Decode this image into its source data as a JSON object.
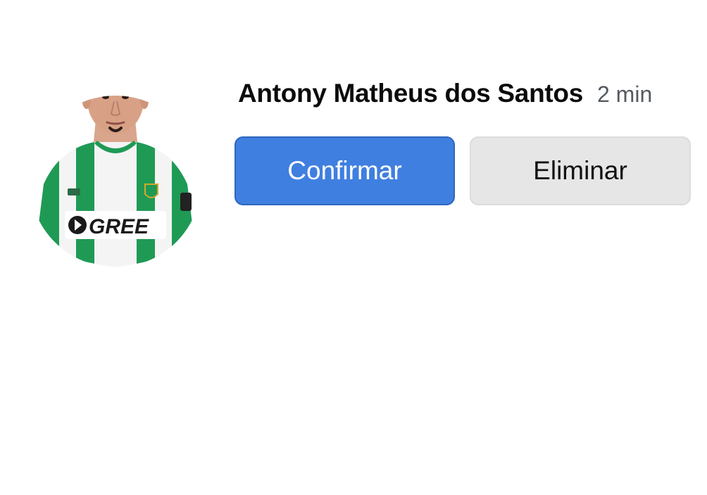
{
  "friend_request": {
    "name": "Antony Matheus dos Santos",
    "time": "2 min",
    "avatar": {
      "kit_sponsor": "GREE",
      "kit_colors": {
        "green": "#1f9a55",
        "white": "#f5f5f5"
      }
    },
    "confirm_label": "Confirmar",
    "delete_label": "Eliminar"
  },
  "colors": {
    "confirm_button": "#3f7fe0",
    "delete_button": "#e6e6e6",
    "name_text": "#0b0b0b",
    "time_text": "#555a60"
  }
}
